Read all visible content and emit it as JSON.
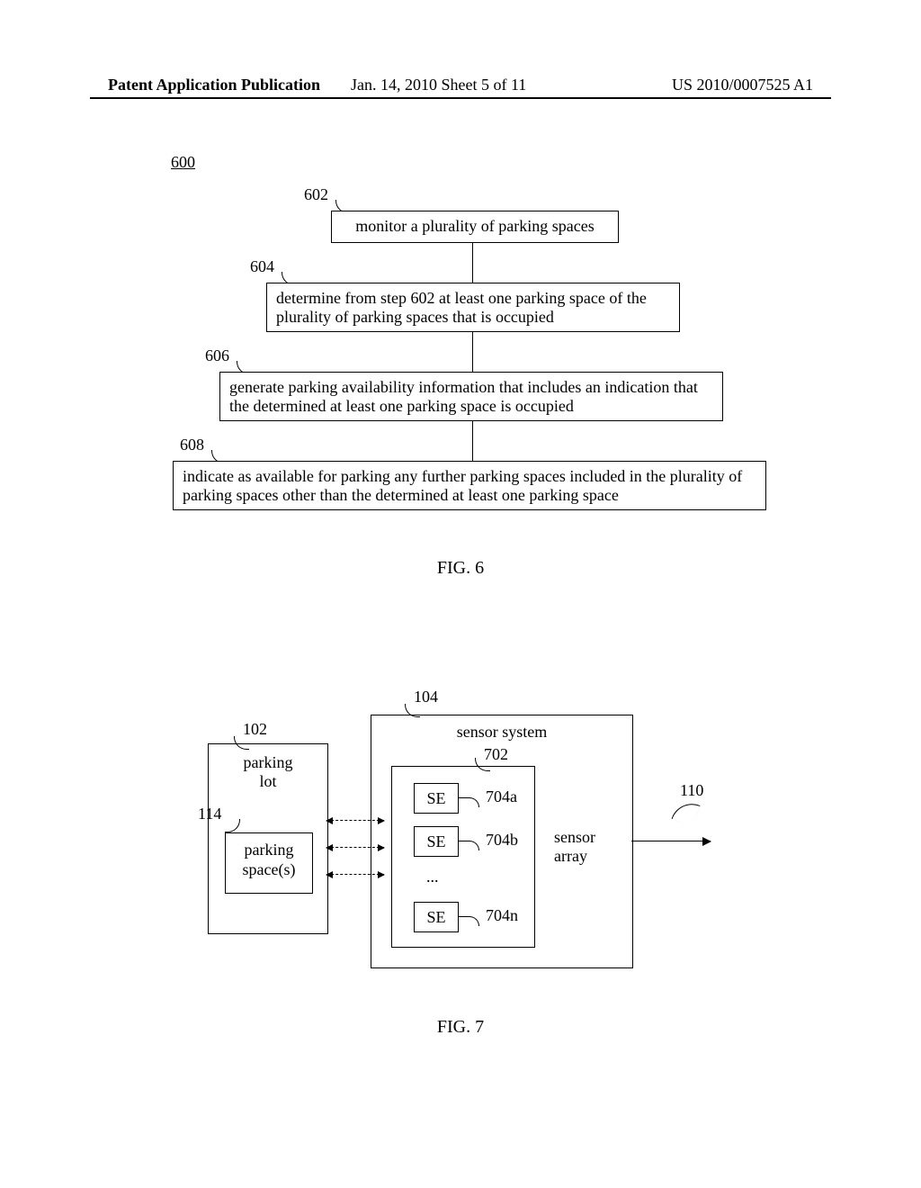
{
  "header": {
    "left": "Patent Application Publication",
    "center": "Jan. 14, 2010  Sheet 5 of 11",
    "right": "US 2010/0007525 A1"
  },
  "fig6": {
    "ref": "600",
    "steps": {
      "s602": {
        "num": "602",
        "text": "monitor a plurality of parking spaces"
      },
      "s604": {
        "num": "604",
        "text": "determine from step 602 at least one parking space of the plurality of parking spaces that is occupied"
      },
      "s606": {
        "num": "606",
        "text": "generate parking availability information that includes an indication that the determined at least one parking space is occupied"
      },
      "s608": {
        "num": "608",
        "text": "indicate as available for parking any further parking spaces included in the plurality of parking spaces other than the determined at least one parking space"
      }
    },
    "caption": "FIG. 6"
  },
  "fig7": {
    "labels": {
      "l104": "104",
      "l102": "102",
      "l114": "114",
      "l702": "702",
      "l704a": "704a",
      "l704b": "704b",
      "l704n": "704n",
      "l110": "110"
    },
    "text": {
      "lot": "parking\nlot",
      "spaces": "parking\nspace(s)",
      "sensor_system": "sensor system",
      "sensor_array": "sensor\narray",
      "SE": "SE",
      "dots": "..."
    },
    "caption": "FIG. 7"
  }
}
